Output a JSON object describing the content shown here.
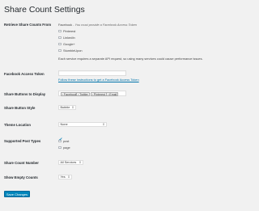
{
  "page": {
    "title": "Share Count Settings"
  },
  "retrieve": {
    "label": "Retrieve Share Counts From",
    "facebook_note_name": "Facebook",
    "facebook_note": " - You must provide a Facebook Access Token",
    "options": [
      "Pinterest",
      "LinkedIn",
      "Google+",
      "StumbleUpon"
    ],
    "help": "Each service requires a separate API request, so using many services could cause performance issues."
  },
  "access_token": {
    "label": "Facebook Access Token",
    "value": "",
    "link": "Follow these instructions to get a Facebook Access Token"
  },
  "buttons_display": {
    "label": "Share Buttons to Display",
    "tags": [
      "Facebook",
      "Twitter",
      "Pinterest",
      "Email"
    ],
    "remove_glyph": "×"
  },
  "button_style": {
    "label": "Share Button Style",
    "value": "Bubble"
  },
  "theme_location": {
    "label": "Theme Location",
    "value": "None"
  },
  "post_types": {
    "label": "Supported Post Types",
    "options": [
      {
        "label": "post",
        "checked": true
      },
      {
        "label": "page",
        "checked": false
      }
    ]
  },
  "share_count_number": {
    "label": "Share Count Number",
    "value": "All Services"
  },
  "show_empty": {
    "label": "Show Empty Counts",
    "value": "Yes"
  },
  "save_button": "Save Changes",
  "icons": {
    "select": "chevron-updown-icon",
    "checkmark": "checkmark-icon"
  },
  "colors": {
    "background": "#f1f1f1",
    "link": "#0073aa",
    "primary_button": "#0085ba"
  }
}
